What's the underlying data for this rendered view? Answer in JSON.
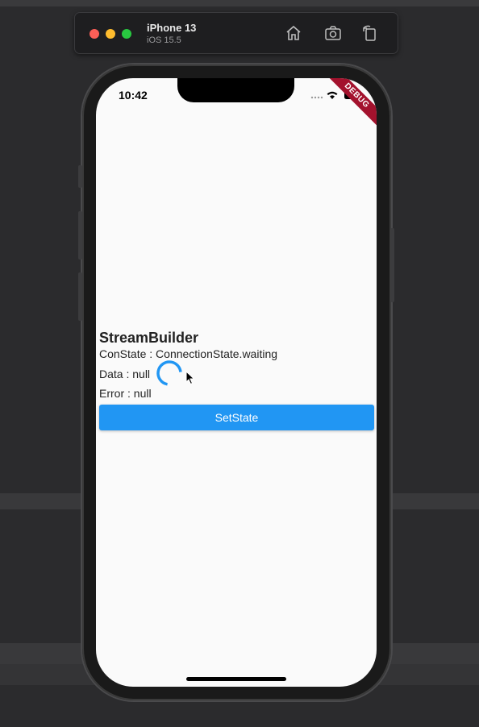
{
  "simulator": {
    "device_name": "iPhone 13",
    "os_version": "iOS 15.5",
    "toolbar_icons": [
      "home-icon",
      "screenshot-icon",
      "rotate-icon"
    ]
  },
  "status_bar": {
    "time": "10:42",
    "icons": [
      "cellular-dots-icon",
      "wifi-icon",
      "battery-icon"
    ]
  },
  "debug_banner": "DEBUG",
  "app": {
    "title": "StreamBuilder",
    "con_state": "ConState : ConnectionState.waiting",
    "data": "Data : null",
    "error": "Error : null",
    "button_label": "SetState",
    "accent_color": "#2196f3"
  }
}
